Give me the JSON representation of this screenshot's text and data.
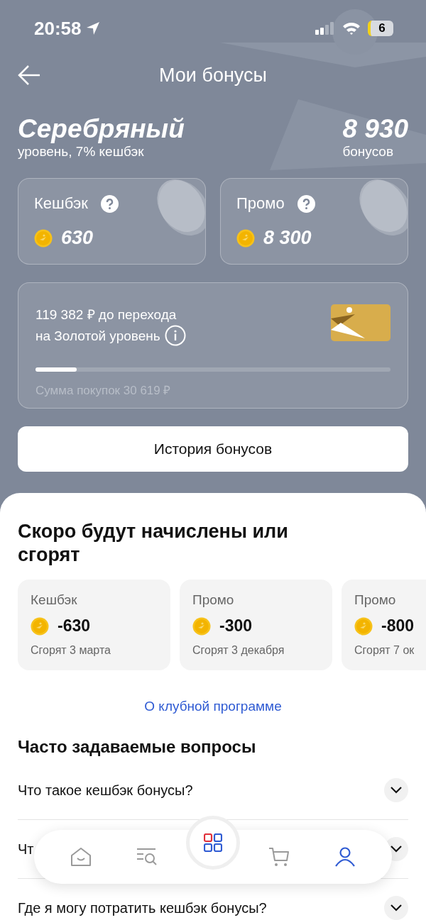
{
  "status_bar": {
    "time": "20:58",
    "battery": "6"
  },
  "header": {
    "title": "Мои бонусы"
  },
  "level": {
    "name": "Серебряный",
    "subtitle": "уровень, 7% кешбэк",
    "total": "8 930",
    "total_label": "бонусов"
  },
  "balances": [
    {
      "label": "Кешбэк",
      "amount": "630"
    },
    {
      "label": "Промо",
      "amount": "8 300"
    }
  ],
  "progress": {
    "text_line_1": "119 382 ₽ до перехода",
    "text_line_2": "на Золотой уровень",
    "level": 0.116,
    "caption": "Сумма покупок 30 619 ₽"
  },
  "history_button": "История бонусов",
  "upcoming": {
    "title": "Скоро будут начислены или сгорят",
    "items": [
      {
        "type": "Кешбэк",
        "amount": "-630",
        "note": "Сгорят 3 марта"
      },
      {
        "type": "Промо",
        "amount": "-300",
        "note": "Сгорят 3 декабря"
      },
      {
        "type": "Промо",
        "amount": "-800",
        "note": "Сгорят 7 ок"
      }
    ]
  },
  "club_link": "О клубной программе",
  "faq": {
    "title": "Часто задаваемые вопросы",
    "items": [
      {
        "question": "Что такое кешбэк бонусы?",
        "expanded": false
      },
      {
        "question": "Чт",
        "expanded": false
      },
      {
        "question": "Где я могу потратить кешбэк бонусы?",
        "expanded": false
      }
    ]
  },
  "nav": [
    {
      "kind": "home",
      "selected": false
    },
    {
      "kind": "search",
      "selected": false
    },
    {
      "kind": "catalog",
      "selected": false
    },
    {
      "kind": "cart",
      "selected": false
    },
    {
      "kind": "profile",
      "selected": true
    }
  ]
}
